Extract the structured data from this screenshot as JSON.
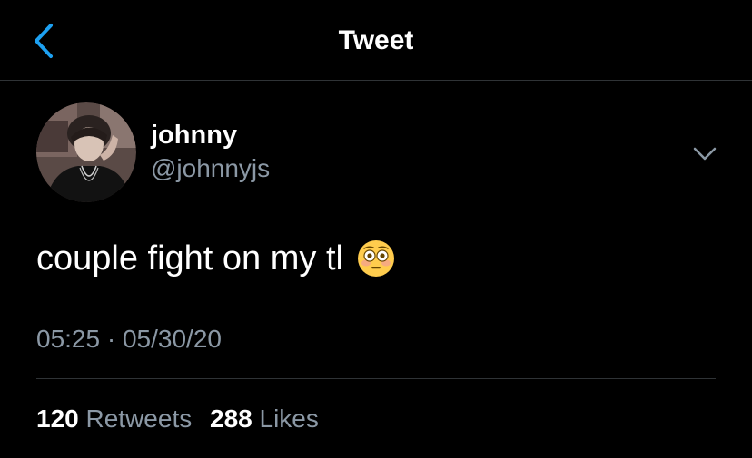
{
  "header": {
    "title": "Tweet",
    "back_icon": "chevron-left-icon",
    "accent_color": "#1da1f2"
  },
  "tweet": {
    "author": {
      "display_name": "johnny",
      "handle": "@johnnyjs"
    },
    "more_icon": "chevron-down-icon",
    "text": "couple fight on my tl",
    "emoji": "flushed-face-emoji",
    "time": "05:25",
    "separator": "·",
    "date": "05/30/20",
    "retweets": {
      "count": "120",
      "label": "Retweets"
    },
    "likes": {
      "count": "288",
      "label": "Likes"
    }
  },
  "colors": {
    "background": "#000000",
    "text_primary": "#ffffff",
    "text_secondary": "#8b98a5",
    "divider": "#2f3336"
  }
}
